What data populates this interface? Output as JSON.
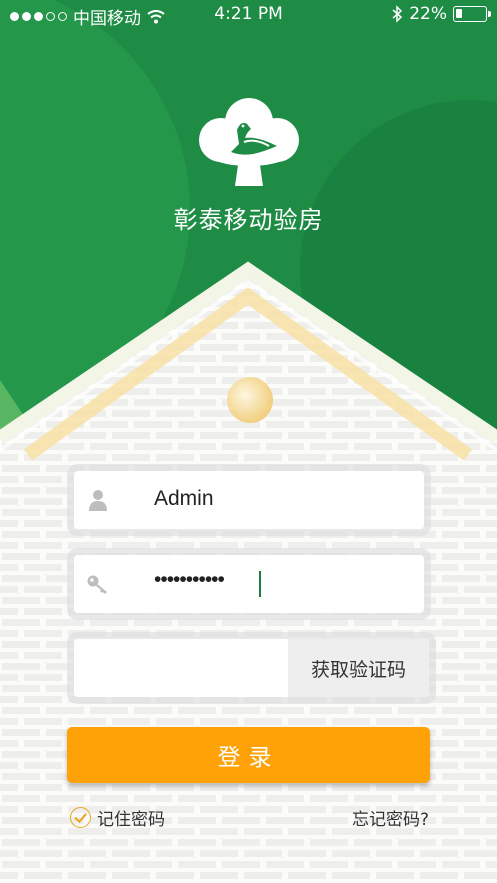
{
  "status_bar": {
    "carrier": "中国移动",
    "time": "4:21 PM",
    "battery": "22%",
    "battery_level": 0.22
  },
  "app": {
    "title": "彰泰移动验房"
  },
  "login": {
    "username": "Admin",
    "password_masked": "•••••••••••",
    "get_code_label": "获取验证码",
    "submit_label": "登录",
    "remember_label": "记住密码",
    "remember_checked": true,
    "forgot_label": "忘记密码?"
  },
  "colors": {
    "brand_green": "#1e8c45",
    "accent_orange": "#ffa207"
  },
  "icons": {
    "user": "user-icon",
    "key": "key-icon",
    "wifi": "wifi-icon",
    "bluetooth": "bluetooth-icon"
  }
}
